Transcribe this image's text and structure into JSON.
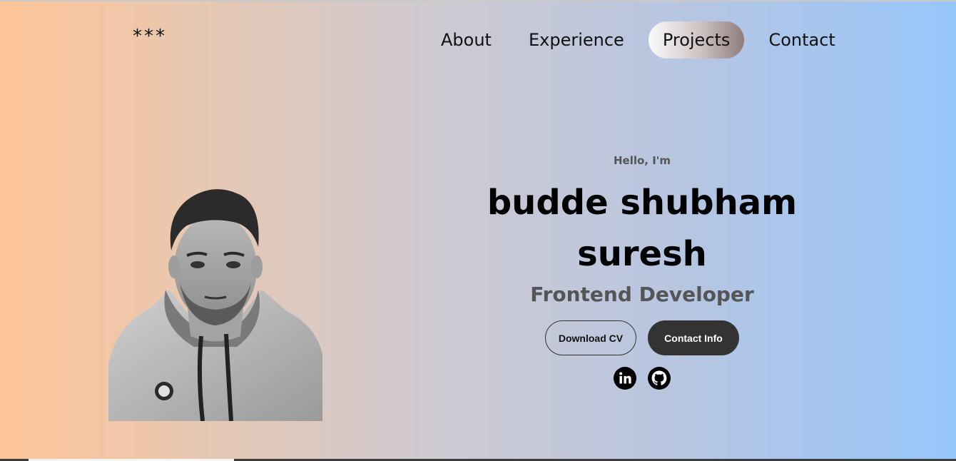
{
  "header": {
    "logo": "***",
    "nav": [
      {
        "label": "About",
        "active": false
      },
      {
        "label": "Experience",
        "active": false
      },
      {
        "label": "Projects",
        "active": true
      },
      {
        "label": "Contact",
        "active": false
      }
    ]
  },
  "hero": {
    "greeting": "Hello, I'm",
    "name_line1": "budde shubham",
    "name_line2": "suresh",
    "role": "Frontend Developer",
    "buttons": {
      "download": "Download CV",
      "contact": "Contact Info"
    },
    "socials": [
      "linkedin-icon",
      "github-icon"
    ]
  },
  "colors": {
    "gradient_left": "#fec598",
    "gradient_right": "#97c6fb",
    "dark_button": "#333333"
  }
}
